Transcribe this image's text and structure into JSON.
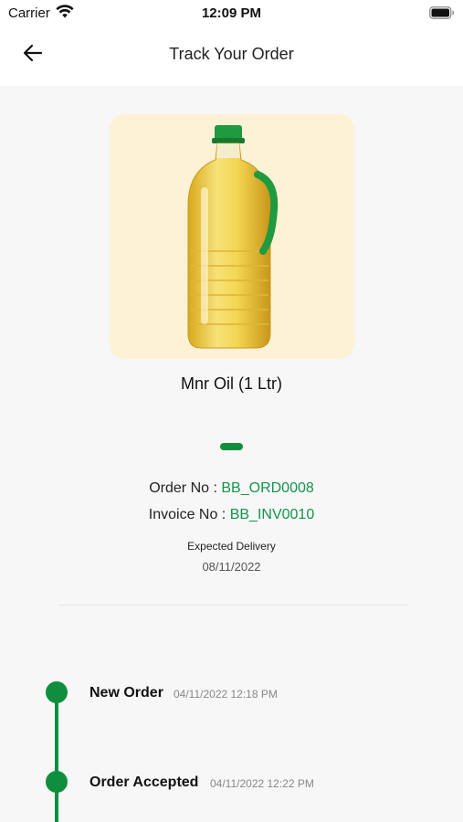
{
  "status_bar": {
    "carrier": "Carrier",
    "time": "12:09 PM",
    "wifi_icon": "wifi-icon",
    "battery_icon": "battery-icon"
  },
  "header": {
    "title": "Track Your Order",
    "back_icon": "arrow-left-icon"
  },
  "product": {
    "name": "Mnr Oil (1 Ltr)",
    "card_color": "#fdf1d6"
  },
  "order": {
    "order_no_label": "Order No :",
    "order_no": "BB_ORD0008",
    "invoice_no_label": "Invoice No :",
    "invoice_no": "BB_INV0010",
    "expected_label": "Expected Delivery",
    "expected_date": "08/11/2022"
  },
  "timeline": [
    {
      "title": "New Order",
      "date": "04/11/2022 12:18 PM"
    },
    {
      "title": "Order Accepted",
      "date": "04/11/2022 12:22 PM"
    }
  ],
  "colors": {
    "accent": "#0f8f3d",
    "accent_text": "#14944a"
  }
}
